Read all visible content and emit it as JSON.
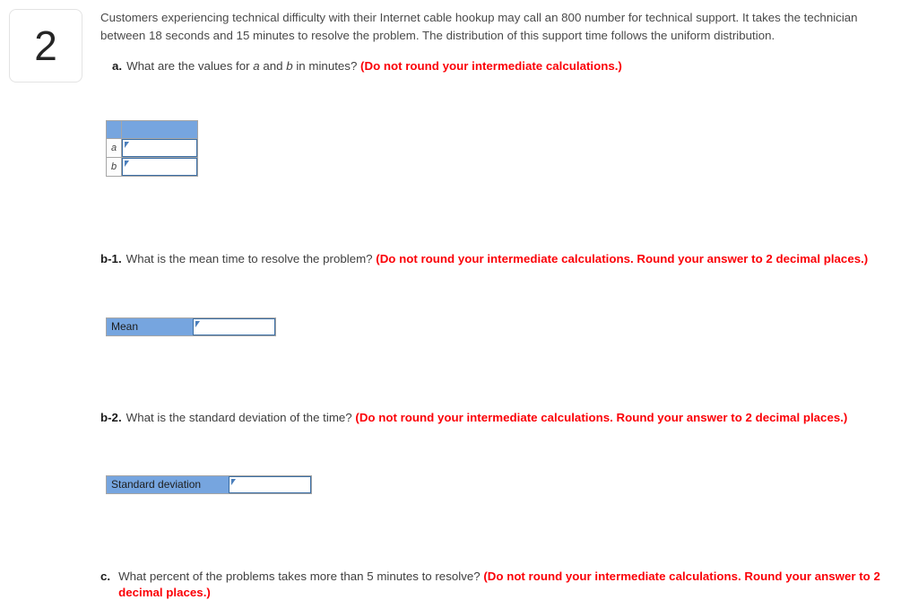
{
  "question": {
    "number": "2",
    "stem": "Customers experiencing technical difficulty with their Internet cable hookup may call an 800 number for technical support. It takes the technician between 18 seconds and 15 minutes to resolve the problem. The distribution of this support time follows the uniform distribution."
  },
  "parts": {
    "a": {
      "label": "a.",
      "text_before_a": "What are the values for ",
      "var_a": "a",
      "text_between": " and ",
      "var_b": "b",
      "text_after": " in minutes? ",
      "note": "(Do not round your intermediate calculations.)"
    },
    "b1": {
      "label": "b-1.",
      "text": "What is the mean time to resolve the problem? ",
      "note": "(Do not round your intermediate calculations. Round your answer to 2 decimal places.)"
    },
    "b2": {
      "label": "b-2.",
      "text": "What is the standard deviation of the time? ",
      "note": "(Do not round your intermediate calculations. Round your answer to 2 decimal places.)"
    },
    "c": {
      "label": "c.",
      "text": "What percent of the problems takes more than 5 minutes to resolve? ",
      "note": "(Do not round your intermediate calculations. Round your answer to 2 decimal places.)"
    }
  },
  "answer_table": {
    "header": [
      "",
      ""
    ],
    "rows": [
      {
        "label": "a",
        "value": ""
      },
      {
        "label": "b",
        "value": ""
      }
    ]
  },
  "mean_row": {
    "label": "Mean",
    "value": ""
  },
  "sd_row": {
    "label": "Standard deviation",
    "value": ""
  },
  "colors": {
    "header_blue": "#76a5df",
    "note_red": "#fb0007",
    "input_border": "#3a6ea5",
    "table_border": "#a6a6a6"
  }
}
